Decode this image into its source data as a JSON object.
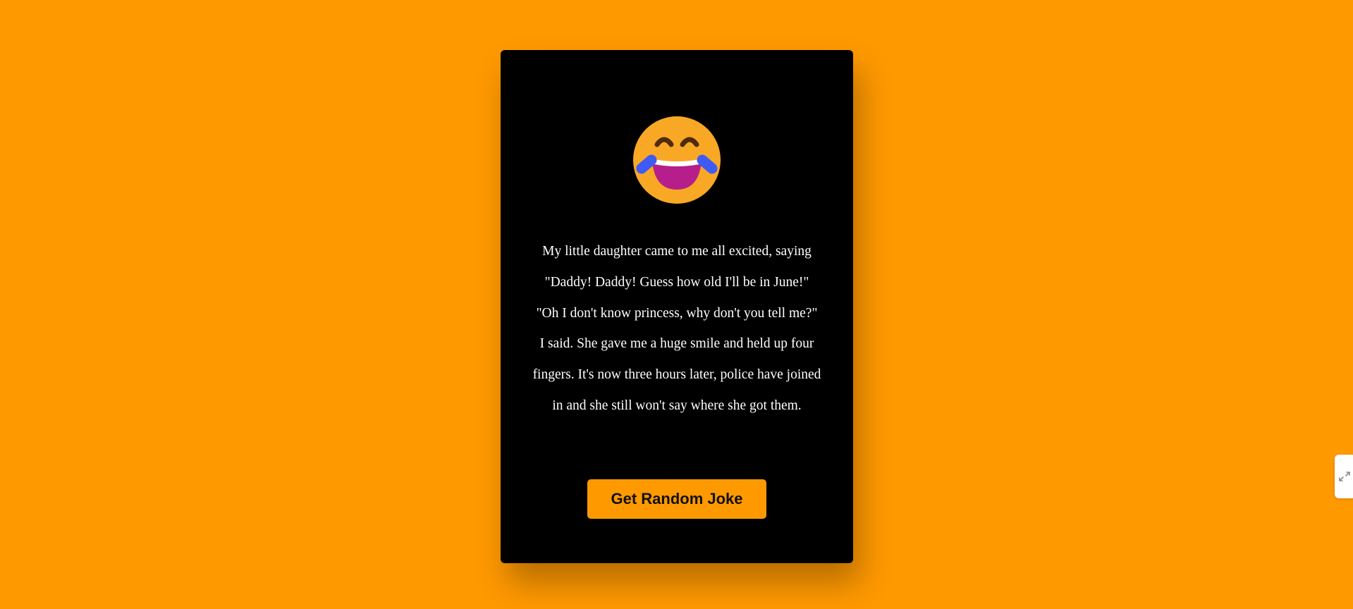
{
  "joke": {
    "text": "My little daughter came to me all excited, saying \"Daddy! Daddy! Guess how old I'll be in June!\" \"Oh I don't know princess, why don't you tell me?\" I said. She gave me a huge smile and held up four fingers. It's now three hours later, police have joined in and she still won't say where she got them."
  },
  "button": {
    "label": "Get Random Joke"
  },
  "icons": {
    "emoji": "laughing-tears-emoji-icon",
    "side_widget": "expand-icon"
  },
  "colors": {
    "background": "#FF9900",
    "card": "#000000",
    "button": "#FF9900",
    "joke_text": "#FFFFFF"
  }
}
